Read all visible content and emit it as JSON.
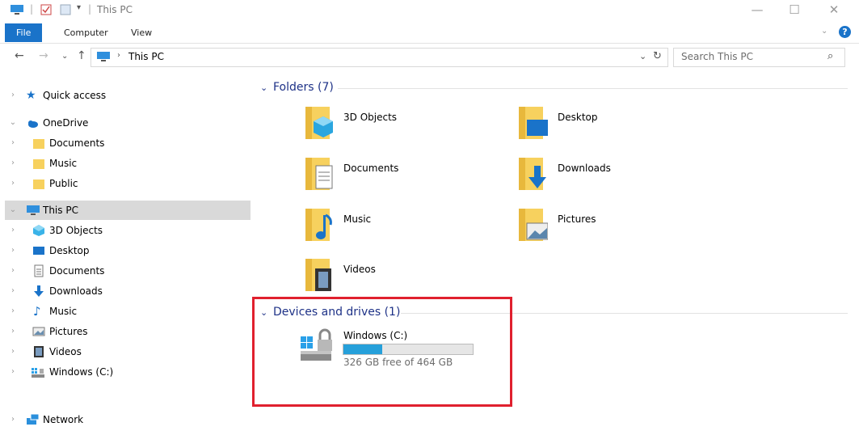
{
  "window": {
    "title": "This PC",
    "separator": "|"
  },
  "ribbon": {
    "tabs": [
      "File",
      "Computer",
      "View"
    ]
  },
  "address": {
    "path_label": "This PC",
    "search_placeholder": "Search This PC"
  },
  "sidebar": {
    "items": [
      {
        "label": "Quick access"
      },
      {
        "label": "OneDrive"
      },
      {
        "label": "Documents"
      },
      {
        "label": "Music"
      },
      {
        "label": "Public"
      },
      {
        "label": "This PC"
      },
      {
        "label": "3D Objects"
      },
      {
        "label": "Desktop"
      },
      {
        "label": "Documents"
      },
      {
        "label": "Downloads"
      },
      {
        "label": "Music"
      },
      {
        "label": "Pictures"
      },
      {
        "label": "Videos"
      },
      {
        "label": "Windows (C:)"
      },
      {
        "label": "Network"
      }
    ]
  },
  "folders_section": {
    "header": "Folders (7)",
    "items": [
      {
        "label": "3D Objects",
        "icon": "3d-objects-folder-icon"
      },
      {
        "label": "Desktop",
        "icon": "desktop-folder-icon"
      },
      {
        "label": "Documents",
        "icon": "documents-folder-icon"
      },
      {
        "label": "Downloads",
        "icon": "downloads-folder-icon"
      },
      {
        "label": "Music",
        "icon": "music-folder-icon"
      },
      {
        "label": "Pictures",
        "icon": "pictures-folder-icon"
      },
      {
        "label": "Videos",
        "icon": "videos-folder-icon"
      }
    ]
  },
  "devices_section": {
    "header": "Devices and drives (1)",
    "drive": {
      "label": "Windows (C:)",
      "free_text": "326 GB free of 464 GB",
      "used_fraction": 0.297
    }
  },
  "colors": {
    "accent": "#1a73c9",
    "section_header": "#1e3287",
    "drive_bar": "#26a0da",
    "highlight": "#e0202e"
  }
}
